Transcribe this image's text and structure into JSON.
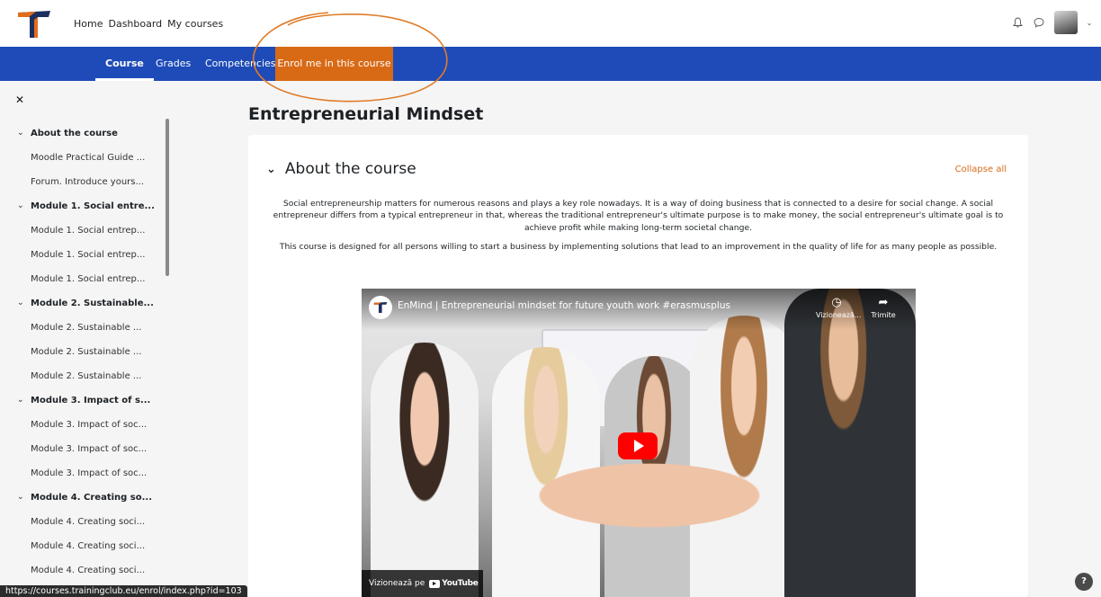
{
  "topnav": {
    "items": [
      "Home",
      "Dashboard",
      "My courses"
    ]
  },
  "secnav": {
    "course": "Course",
    "grades": "Grades",
    "competencies": "Competencies",
    "enrol": "Enrol me in this course"
  },
  "sidebar": {
    "items": [
      {
        "label": "About the course",
        "section": true
      },
      {
        "label": "Moodle Practical Guide ...",
        "section": false
      },
      {
        "label": "Forum. Introduce yours...",
        "section": false
      },
      {
        "label": "Module 1. Social entre...",
        "section": true
      },
      {
        "label": "Module 1. Social entrep...",
        "section": false
      },
      {
        "label": "Module 1. Social entrep...",
        "section": false
      },
      {
        "label": "Module 1. Social entrep...",
        "section": false
      },
      {
        "label": "Module 2. Sustainable...",
        "section": true
      },
      {
        "label": "Module 2. Sustainable ...",
        "section": false
      },
      {
        "label": "Module 2. Sustainable ...",
        "section": false
      },
      {
        "label": "Module 2. Sustainable ...",
        "section": false
      },
      {
        "label": "Module 3. Impact of s...",
        "section": true
      },
      {
        "label": "Module 3. Impact of soc...",
        "section": false
      },
      {
        "label": "Module 3. Impact of soc...",
        "section": false
      },
      {
        "label": "Module 3. Impact of soc...",
        "section": false
      },
      {
        "label": "Module 4. Creating so...",
        "section": true
      },
      {
        "label": "Module 4. Creating soci...",
        "section": false
      },
      {
        "label": "Module 4. Creating soci...",
        "section": false
      },
      {
        "label": "Module 4. Creating soci...",
        "section": false
      }
    ]
  },
  "main": {
    "page_title": "Entrepreneurial Mindset",
    "section_title": "About the course",
    "collapse_all": "Collapse all",
    "summary_p1": "Social entrepreneurship matters for numerous reasons and plays a key role nowadays. It is a way of doing business that is connected to a desire for social change. A social entrepreneur differs from a typical entrepreneur in that, whereas the traditional entrepreneur's ultimate purpose is to make money, the social entrepreneur's ultimate goal is to  achieve profit while making long-term societal change.",
    "summary_p2": "This course is designed for all persons willing to start a business by implementing solutions that lead to an improvement in the quality of life for as many people as possible."
  },
  "video": {
    "title": "EnMind | Entrepreneurial mindset for future youth work #erasmusplus",
    "watch_later": "Vizionează...",
    "share": "Trimite",
    "watch_on": "Vizionează pe",
    "youtube": "YouTube"
  },
  "statusbar": {
    "url": "https://courses.trainingclub.eu/enrol/index.php?id=103"
  },
  "help": {
    "label": "?"
  },
  "colors": {
    "primary_blue": "#1e4bb8",
    "accent_orange": "#d86a16",
    "annotation": "#e07b28"
  }
}
